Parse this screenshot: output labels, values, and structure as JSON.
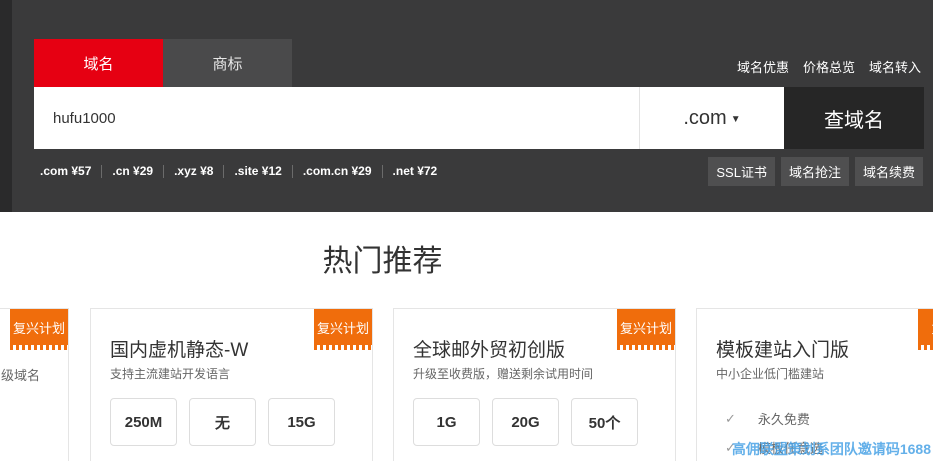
{
  "search": {
    "tabs": [
      {
        "label": "域名",
        "active": true
      },
      {
        "label": "商标",
        "active": false
      }
    ],
    "quick_links": [
      "域名优惠",
      "价格总览",
      "域名转入"
    ],
    "input_value": "hufu1000",
    "tld": ".com",
    "button_label": "查域名",
    "prices": [
      ".com ¥57",
      ".cn ¥29",
      ".xyz ¥8",
      ".site ¥12",
      ".com.cn ¥29",
      ".net ¥72"
    ],
    "services": [
      "SSL证书",
      "域名抢注",
      "域名续费"
    ]
  },
  "hot": {
    "title": "热门推荐",
    "partial_left": {
      "badge": "复兴计划",
      "sub": "级域名"
    },
    "cards": [
      {
        "badge": "复兴计划",
        "title": "国内虚机静态-W",
        "sub": "支持主流建站开发语言",
        "specs": [
          "250M",
          "无",
          "15G"
        ]
      },
      {
        "badge": "复兴计划",
        "title": "全球邮外贸初创版",
        "sub": "升级至收费版，赠送剩余试用时间",
        "specs": [
          "1G",
          "20G",
          "50个"
        ]
      },
      {
        "badge": "复",
        "title": "模板建站入门版",
        "sub": "中小企业低门槛建站",
        "features": [
          "永久免费",
          "模板任意选"
        ]
      }
    ]
  },
  "watermark": "高佣联盟策划系团队邀请码1688",
  "colors": {
    "accent": "#e60012",
    "badge": "#f06d0c",
    "band": "#3a3a3b"
  }
}
